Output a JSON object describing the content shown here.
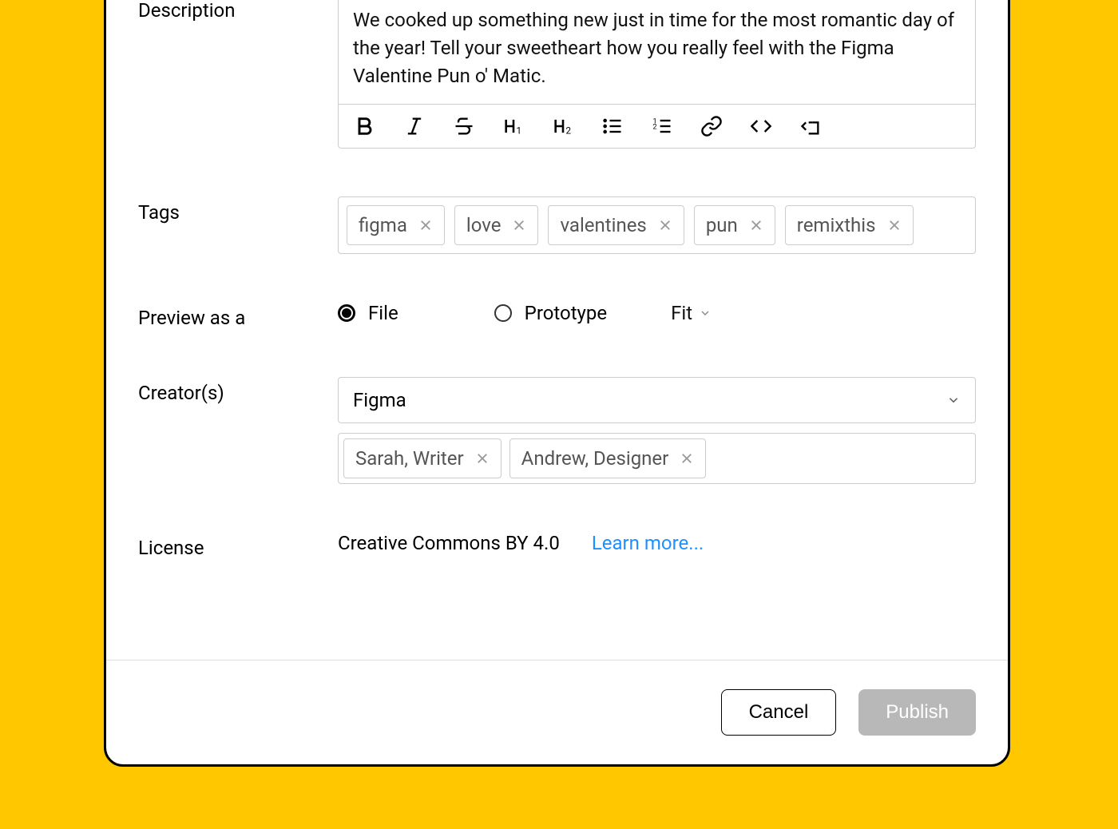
{
  "labels": {
    "description": "Description",
    "tags": "Tags",
    "preview_as": "Preview as a",
    "creators": "Creator(s)",
    "license": "License"
  },
  "description": {
    "text": "We cooked up something new just in time for the most romantic day of the year! Tell your sweetheart how you really feel with the Figma Valentine Pun o' Matic."
  },
  "toolbar_icons": [
    "bold",
    "italic",
    "strikethrough",
    "h1",
    "h2",
    "bullet-list",
    "numbered-list",
    "link",
    "code",
    "code-block"
  ],
  "tags": [
    "figma",
    "love",
    "valentines",
    "pun",
    "remixthis"
  ],
  "preview": {
    "options": [
      "File",
      "Prototype"
    ],
    "selected": "File",
    "fit_label": "Fit"
  },
  "creators": {
    "primary": "Figma",
    "people": [
      "Sarah, Writer",
      "Andrew, Designer"
    ]
  },
  "license": {
    "name": "Creative Commons BY 4.0",
    "learn_more": "Learn more..."
  },
  "footer": {
    "cancel": "Cancel",
    "publish": "Publish"
  }
}
